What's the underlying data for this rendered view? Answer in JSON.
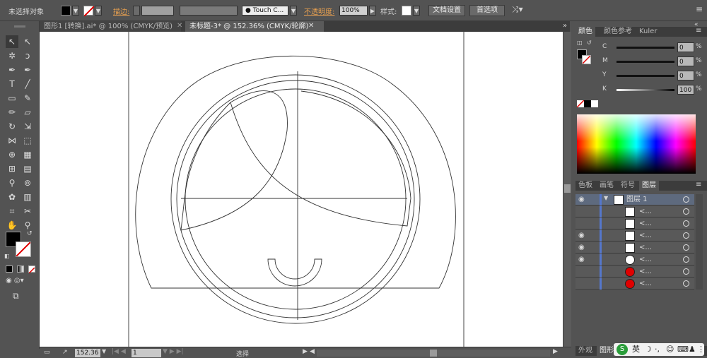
{
  "control_bar": {
    "selection_status": "未选择对象",
    "stroke_label": "描边:",
    "brush_value": "Touch C...",
    "opacity_label": "不透明度:",
    "opacity_value": "100%",
    "style_label": "样式:",
    "doc_setup_label": "文档设置",
    "prefs_label": "首选项"
  },
  "tabs": [
    {
      "label": "图形1 [转换].ai* @ 100% (CMYK/预览)"
    },
    {
      "label": "未标题-3* @ 152.36% (CMYK/轮廓)"
    }
  ],
  "status_bar": {
    "zoom": "152.36",
    "artboard": "1",
    "tool_status": "选择"
  },
  "color_panel": {
    "tabs": [
      "颜色",
      "颜色参考",
      "Kuler"
    ],
    "channels": [
      {
        "label": "C",
        "value": "0"
      },
      {
        "label": "M",
        "value": "0"
      },
      {
        "label": "Y",
        "value": "0"
      },
      {
        "label": "K",
        "value": "100"
      }
    ]
  },
  "layers_panel": {
    "tabs": [
      "色板",
      "画笔",
      "符号",
      "图层"
    ],
    "layer_name": "图层 1",
    "sublayers": [
      {
        "label": "<..."
      },
      {
        "label": "<..."
      },
      {
        "label": "<..."
      },
      {
        "label": "<..."
      },
      {
        "label": "<..."
      },
      {
        "label": "<..."
      },
      {
        "label": "<..."
      }
    ]
  },
  "bottom_panel": {
    "tabs": [
      "外观",
      "图形样"
    ]
  },
  "ime": {
    "lang": "英"
  },
  "colors": {
    "fill_swatch": "#000000",
    "red_swatch": "#e00000"
  }
}
